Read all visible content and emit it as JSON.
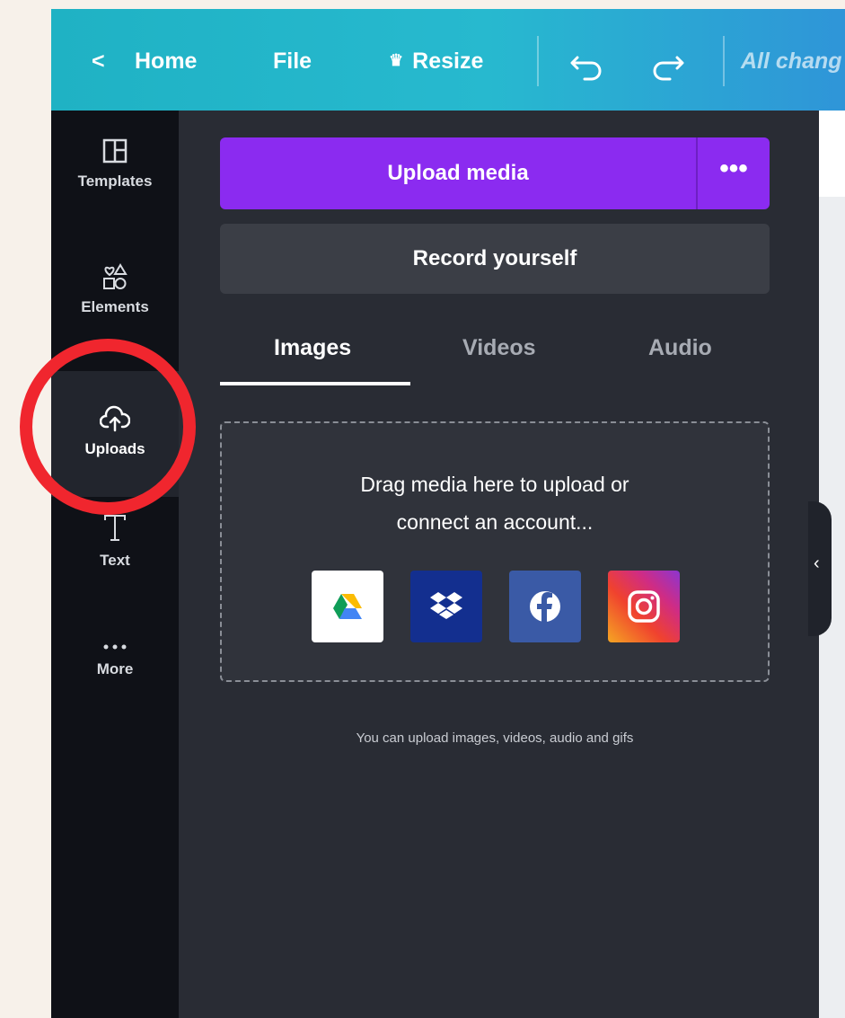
{
  "topbar": {
    "back_glyph": "<",
    "home": "Home",
    "file": "File",
    "resize": "Resize",
    "status": "All chang"
  },
  "rail": {
    "items": [
      {
        "label": "Templates",
        "icon": "templates-icon"
      },
      {
        "label": "Elements",
        "icon": "elements-icon"
      },
      {
        "label": "Uploads",
        "icon": "upload-cloud-icon",
        "active": true
      },
      {
        "label": "Text",
        "icon": "text-icon"
      },
      {
        "label": "More",
        "icon": "more-icon"
      }
    ]
  },
  "panel": {
    "upload_button": "Upload media",
    "upload_more": "•••",
    "record_button": "Record yourself",
    "tabs": [
      "Images",
      "Videos",
      "Audio"
    ],
    "active_tab": "Images",
    "dropzone": {
      "line1": "Drag media here to upload or",
      "line2": "connect an account...",
      "services": [
        "Google Drive",
        "Dropbox",
        "Facebook",
        "Instagram"
      ]
    },
    "hint": "You can upload images, videos, audio and gifs"
  },
  "colors": {
    "topbar_start": "#1fb2c4",
    "topbar_end": "#2f95d8",
    "upload_button": "#8b2bf0",
    "highlight_ring": "#f0262e",
    "panel_bg": "#292c34",
    "rail_bg": "#0f1117"
  }
}
